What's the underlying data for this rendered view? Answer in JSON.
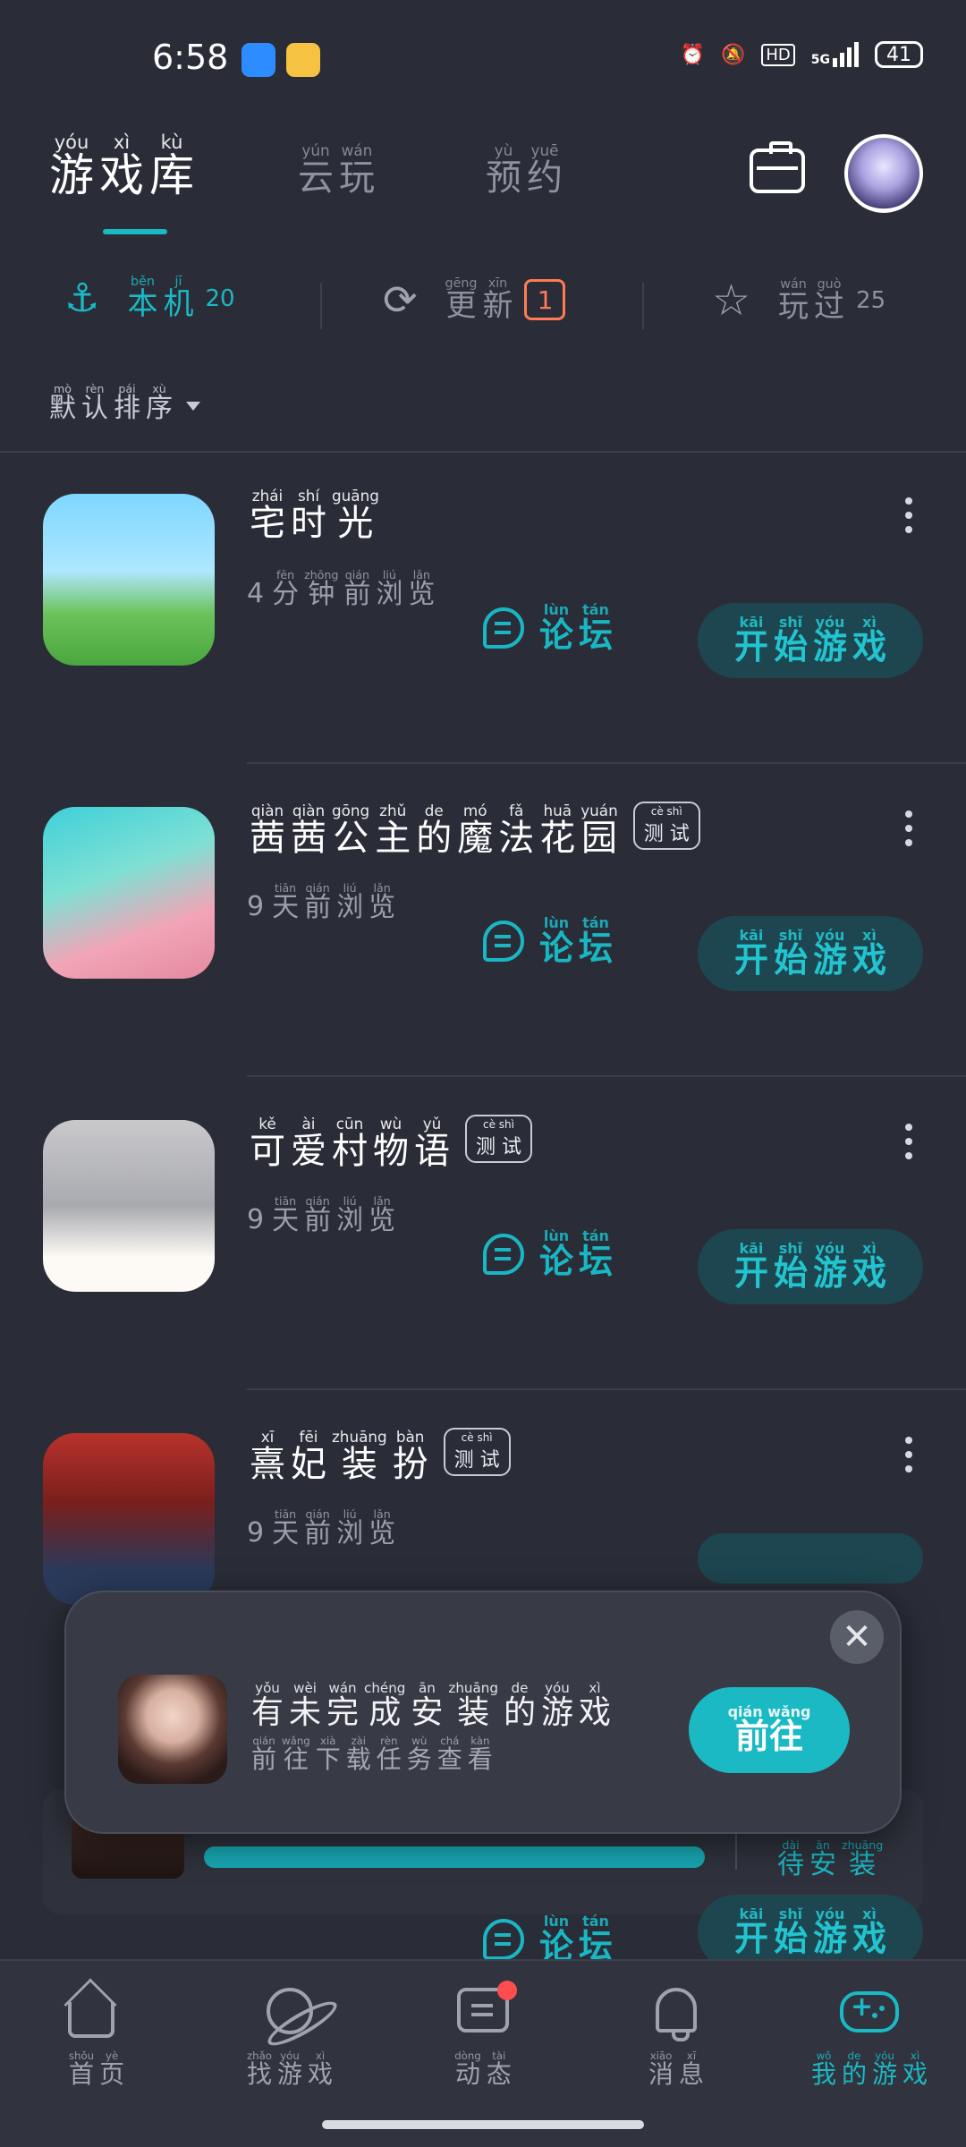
{
  "status": {
    "time": "6:58",
    "net": "5G",
    "battery": "41",
    "hd": "HD"
  },
  "header": {
    "tabs": [
      {
        "pinyin": [
          "yóu",
          "xì",
          "kù"
        ],
        "hanzi": [
          "游",
          "戏",
          "库"
        ]
      },
      {
        "pinyin": [
          "yún",
          "wán"
        ],
        "hanzi": [
          "云",
          "玩"
        ]
      },
      {
        "pinyin": [
          "yù",
          "yuē"
        ],
        "hanzi": [
          "预",
          "约"
        ]
      }
    ]
  },
  "filters": [
    {
      "pinyin": [
        "běn",
        "jī"
      ],
      "hanzi": [
        "本",
        "机"
      ],
      "count": "20",
      "color": "#1ab9c4"
    },
    {
      "pinyin": [
        "gēng",
        "xīn"
      ],
      "hanzi": [
        "更",
        "新"
      ],
      "badge": "1",
      "color": "#8d929e"
    },
    {
      "pinyin": [
        "wán",
        "guò"
      ],
      "hanzi": [
        "玩",
        "过"
      ],
      "count": "25",
      "color": "#8d929e"
    }
  ],
  "sort": {
    "pinyin": [
      "mò",
      "rèn",
      "pái",
      "xù"
    ],
    "hanzi": [
      "默",
      "认",
      "排",
      "序"
    ]
  },
  "buttons": {
    "forum": {
      "pinyin": [
        "lùn",
        "tán"
      ],
      "hanzi": [
        "论",
        "坛"
      ]
    },
    "play": {
      "pinyin": [
        "kāi",
        "shǐ",
        "yóu",
        "xì"
      ],
      "hanzi": [
        "开",
        "始",
        "游",
        "戏"
      ]
    }
  },
  "test_badge": {
    "pinyin": "cè shì",
    "hanzi": "测 试"
  },
  "games": [
    {
      "pinyin": [
        "zhái",
        "shí",
        "guāng"
      ],
      "hanzi": [
        "宅",
        "时",
        "光"
      ],
      "test": false,
      "sub_num": "4",
      "sub_pinyin": [
        "fēn",
        "zhōng",
        "qián",
        "liú",
        "lǎn"
      ],
      "sub_hanzi": [
        "分",
        "钟",
        "前",
        "浏",
        "览"
      ]
    },
    {
      "pinyin": [
        "qiàn",
        "qiàn",
        "gōng",
        "zhǔ",
        "de",
        "mó",
        "fǎ",
        "huā",
        "yuán"
      ],
      "hanzi": [
        "茜",
        "茜",
        "公",
        "主",
        "的",
        "魔",
        "法",
        "花",
        "园"
      ],
      "test": true,
      "sub_num": "9",
      "sub_pinyin": [
        "tiān",
        "qián",
        "liú",
        "lǎn"
      ],
      "sub_hanzi": [
        "天",
        "前",
        "浏",
        "览"
      ]
    },
    {
      "pinyin": [
        "kě",
        "ài",
        "cūn",
        "wù",
        "yǔ"
      ],
      "hanzi": [
        "可",
        "爱",
        "村",
        "物",
        "语"
      ],
      "test": true,
      "sub_num": "9",
      "sub_pinyin": [
        "tiān",
        "qián",
        "liú",
        "lǎn"
      ],
      "sub_hanzi": [
        "天",
        "前",
        "浏",
        "览"
      ]
    },
    {
      "pinyin": [
        "xī",
        "fēi",
        "zhuāng",
        "bàn"
      ],
      "hanzi": [
        "熹",
        "妃",
        "装",
        "扮"
      ],
      "test": true,
      "sub_num": "9",
      "sub_pinyin": [
        "tiān",
        "qián",
        "liú",
        "lǎn"
      ],
      "sub_hanzi": [
        "天",
        "前",
        "浏",
        "览"
      ]
    }
  ],
  "popup": {
    "title_pinyin": [
      "yǒu",
      "wèi",
      "wán",
      "chéng",
      "ān",
      "zhuāng",
      "de",
      "yóu",
      "xì"
    ],
    "title_hanzi": [
      "有",
      "未",
      "完",
      "成",
      "安",
      "装",
      "的",
      "游",
      "戏"
    ],
    "sub_pinyin": [
      "qián",
      "wǎng",
      "xià",
      "zài",
      "rèn",
      "wù",
      "chá",
      "kàn"
    ],
    "sub_hanzi": [
      "前",
      "往",
      "下",
      "载",
      "任",
      "务",
      "查",
      "看"
    ],
    "go_pinyin": "qián wǎng",
    "go_hanzi": "前往",
    "close_symbol": "✕"
  },
  "download": {
    "status_pinyin": [
      "dài",
      "ān",
      "zhuāng"
    ],
    "status_hanzi": [
      "待",
      "安",
      "装"
    ]
  },
  "nav": [
    {
      "pinyin": [
        "shǒu",
        "yè"
      ],
      "hanzi": [
        "首",
        "页"
      ],
      "icon": "home-icon"
    },
    {
      "pinyin": [
        "zhǎo",
        "yóu",
        "xì"
      ],
      "hanzi": [
        "找",
        "游",
        "戏"
      ],
      "icon": "planet-icon"
    },
    {
      "pinyin": [
        "dòng",
        "tài"
      ],
      "hanzi": [
        "动",
        "态"
      ],
      "icon": "chat-icon"
    },
    {
      "pinyin": [
        "xiāo",
        "xī"
      ],
      "hanzi": [
        "消",
        "息"
      ],
      "icon": "bell-icon"
    },
    {
      "pinyin": [
        "wǒ",
        "de",
        "yóu",
        "xì"
      ],
      "hanzi": [
        "我",
        "的",
        "游",
        "戏"
      ],
      "icon": "gamepad-icon"
    }
  ],
  "colors": {
    "accent": "#1ab9c4",
    "background": "#2a2d37",
    "badge": "#ff7a55",
    "notify": "#ff4d4f"
  }
}
